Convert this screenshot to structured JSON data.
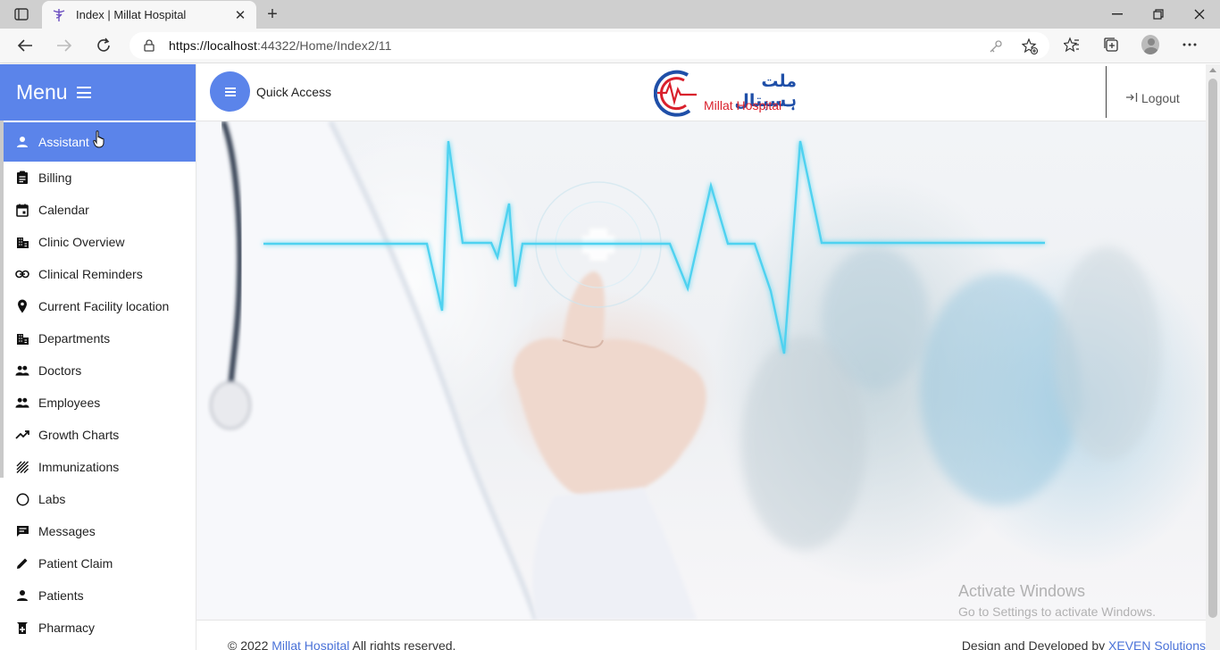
{
  "browser": {
    "tab_title": "Index | Millat Hospital",
    "url_host": "https://localhost",
    "url_rest": ":44322/Home/Index2/11"
  },
  "sidebar": {
    "title": "Menu",
    "items": [
      {
        "label": "Assistant",
        "icon": "person-icon",
        "active": true
      },
      {
        "label": "Billing",
        "icon": "clipboard-icon"
      },
      {
        "label": "Calendar",
        "icon": "calendar-icon"
      },
      {
        "label": "Clinic Overview",
        "icon": "building-icon"
      },
      {
        "label": "Clinical Reminders",
        "icon": "link-icon"
      },
      {
        "label": "Current Facility location",
        "icon": "location-pin-icon"
      },
      {
        "label": "Departments",
        "icon": "building-icon"
      },
      {
        "label": "Doctors",
        "icon": "people-icon"
      },
      {
        "label": "Employees",
        "icon": "people-icon"
      },
      {
        "label": "Growth Charts",
        "icon": "trending-up-icon"
      },
      {
        "label": "Immunizations",
        "icon": "hatch-icon"
      },
      {
        "label": "Labs",
        "icon": "circle-icon"
      },
      {
        "label": "Messages",
        "icon": "message-icon"
      },
      {
        "label": "Patient Claim",
        "icon": "pencil-icon"
      },
      {
        "label": "Patients",
        "icon": "person-icon"
      },
      {
        "label": "Pharmacy",
        "icon": "pharmacy-icon"
      }
    ]
  },
  "header": {
    "quick_access": "Quick Access",
    "logo_urdu": "ملت ہسپتال",
    "logo_english": "Millat Hospital",
    "logout": "Logout"
  },
  "watermark": {
    "line1": "Activate Windows",
    "line2": "Go to Settings to activate Windows."
  },
  "footer": {
    "copyright_prefix": "© 2022",
    "brand": "Millat Hospital",
    "rights": "All rights reserved.",
    "credit_prefix": "Design and Developed by",
    "credit_company": "XEVEN Solutions"
  },
  "colors": {
    "accent": "#5b84ea",
    "link": "#4a72d8",
    "ecg_line": "#4fd2f0"
  }
}
